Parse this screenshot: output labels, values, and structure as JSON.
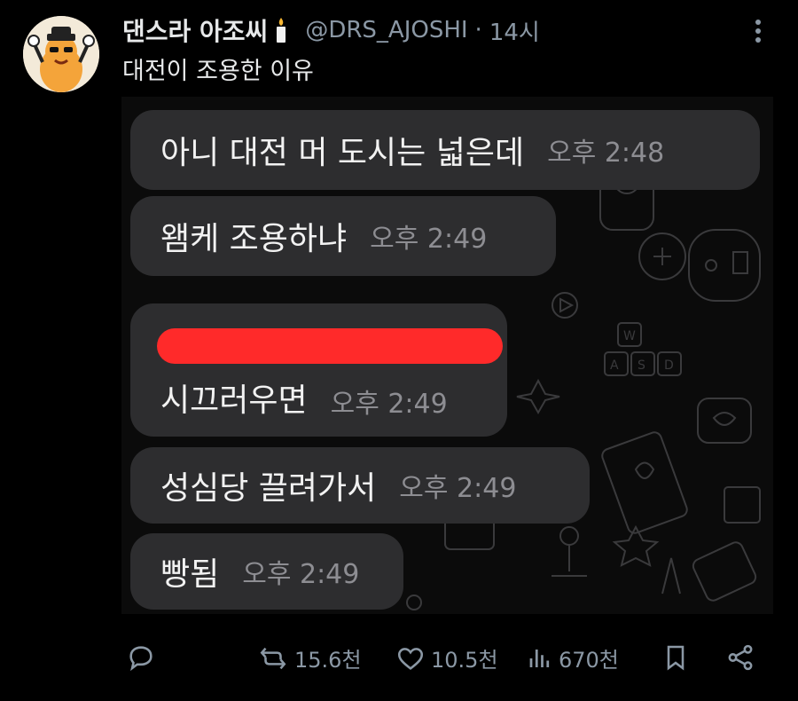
{
  "tweet": {
    "display_name": "댄스라 아조씨",
    "handle": "@DRS_AJOSHI",
    "separator": "·",
    "time": "14시",
    "text": "대전이 조용한 이유",
    "icons": [
      "avatar",
      "candle-icon",
      "more-icon"
    ]
  },
  "chat": {
    "messages": [
      {
        "text": "아니 대전 머 도시는 넓은데",
        "time": "오후 2:48"
      },
      {
        "text": "왬케 조용하냐",
        "time": "오후 2:49"
      },
      {
        "text": "시끄러우면",
        "time": "오후 2:49",
        "redacted_line": true
      },
      {
        "text": "성심당 끌려가서",
        "time": "오후 2:49"
      },
      {
        "text": "빵됨",
        "time": "오후 2:49"
      }
    ],
    "redaction_color": "#ff2a2a"
  },
  "actions": {
    "reply": "",
    "retweet": "15.6천",
    "like": "10.5천",
    "views": "670천",
    "icons": [
      "reply-icon",
      "retweet-icon",
      "like-icon",
      "views-icon",
      "bookmark-icon",
      "share-icon"
    ]
  },
  "colors": {
    "background": "#000000",
    "bubble": "#2d2d2f",
    "muted": "#8b98a5"
  }
}
